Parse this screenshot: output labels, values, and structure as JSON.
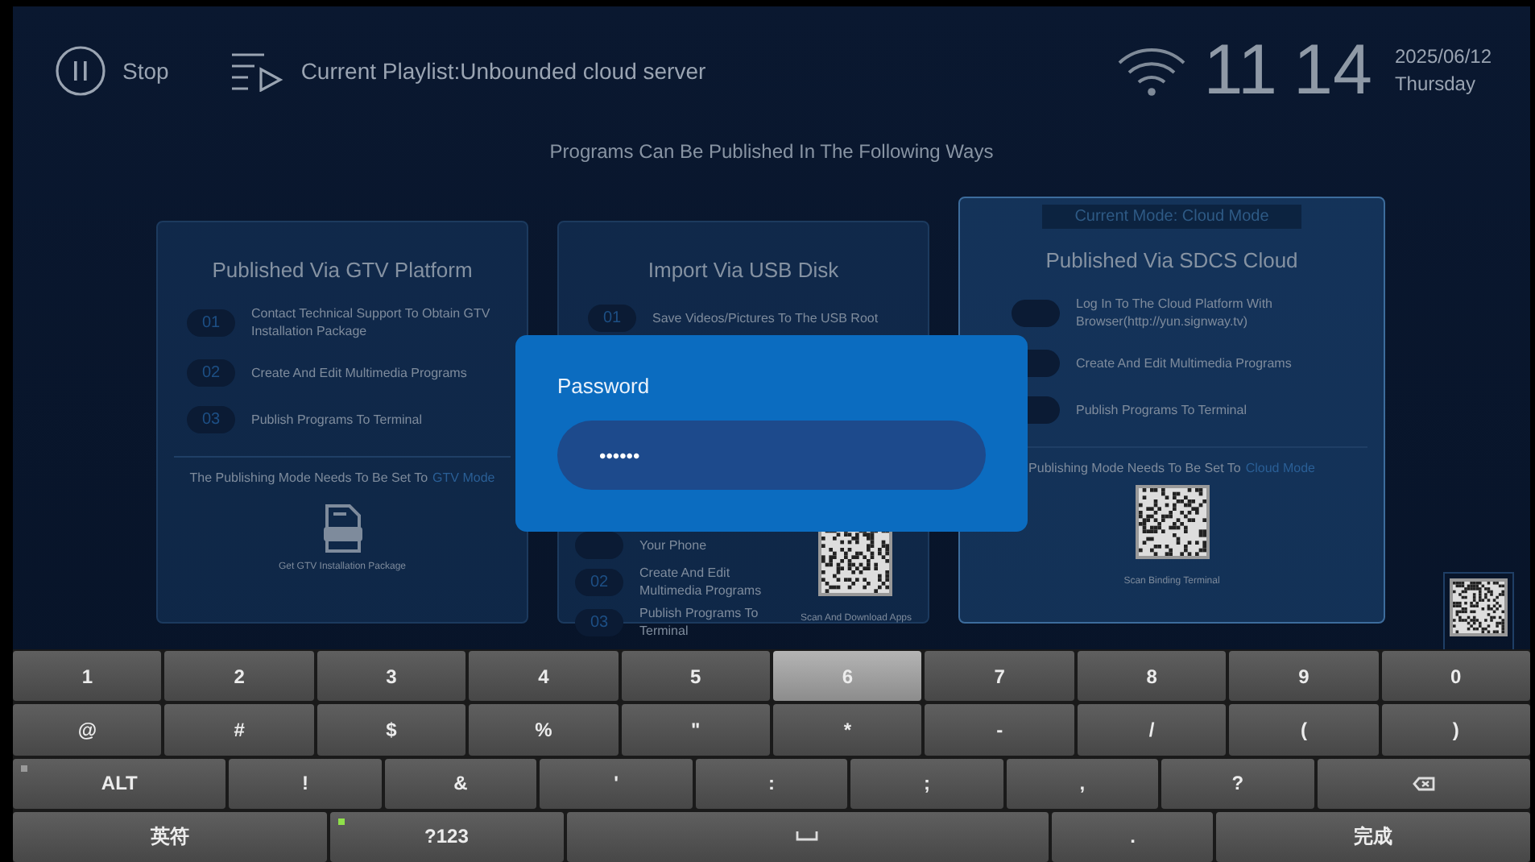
{
  "status_bar": {
    "playback_button": "Stop",
    "playlist": "Current Playlist:Unbounded cloud server",
    "time_hours": "11",
    "time_minutes": "14",
    "date": "2025/06/12",
    "weekday": "Thursday"
  },
  "heading": "Programs Can Be Published In The Following Ways",
  "cards": [
    {
      "title": "Published Via GTV Platform",
      "selected": false,
      "steps": [
        {
          "number": "01",
          "text": "Contact Technical Support To Obtain GTV Installation Package"
        },
        {
          "number": "02",
          "text": "Create And Edit Multimedia Programs"
        },
        {
          "number": "03",
          "text": "Publish Programs To Terminal"
        }
      ],
      "mode_note": "The Publishing Mode Needs To Be Set To",
      "mode_name": "GTV Mode",
      "download": {
        "kind": "package",
        "caption": "Get GTV Installation Package"
      }
    },
    {
      "title": "Import Via USB Disk",
      "selected": false,
      "steps": [
        {
          "number": "01",
          "text": "Save Videos/Pictures To The USB Root"
        }
      ],
      "side_section": {
        "steps": [
          {
            "text": "Your Phone"
          },
          {
            "number": "02",
            "text": "Create And Edit Multimedia Programs"
          },
          {
            "number": "03",
            "text": "Publish Programs To Terminal"
          }
        ],
        "download": {
          "kind": "qr",
          "caption": "Scan And Download Apps"
        }
      }
    },
    {
      "badge": "Current Mode: Cloud Mode",
      "title": "Published Via SDCS Cloud",
      "selected": true,
      "steps": [
        {
          "text": "Log In To The Cloud Platform With Browser(http://yun.signway.tv)"
        },
        {
          "text": "Create And Edit Multimedia Programs"
        },
        {
          "text": "Publish Programs To Terminal"
        }
      ],
      "mode_note": "Publishing Mode Needs To Be Set To",
      "mode_name": "Cloud Mode",
      "download": {
        "kind": "qr",
        "caption": "Scan Binding Terminal"
      }
    }
  ],
  "dialog": {
    "title": "Password",
    "value": "••••••"
  },
  "keyboard": [
    [
      {
        "kind": "char",
        "label": "1",
        "pressed": false
      },
      {
        "kind": "char",
        "label": "2",
        "pressed": false
      },
      {
        "kind": "char",
        "label": "3",
        "pressed": false
      },
      {
        "kind": "char",
        "label": "4",
        "pressed": false
      },
      {
        "kind": "char",
        "label": "5",
        "pressed": false
      },
      {
        "kind": "char",
        "label": "6",
        "pressed": true
      },
      {
        "kind": "char",
        "label": "7",
        "pressed": false
      },
      {
        "kind": "char",
        "label": "8",
        "pressed": false
      },
      {
        "kind": "char",
        "label": "9",
        "pressed": false
      },
      {
        "kind": "char",
        "label": "0",
        "pressed": false
      }
    ],
    [
      {
        "kind": "char",
        "label": "@",
        "pressed": false
      },
      {
        "kind": "char",
        "label": "#",
        "pressed": false
      },
      {
        "kind": "char",
        "label": "$",
        "pressed": false
      },
      {
        "kind": "char",
        "label": "%",
        "pressed": false
      },
      {
        "kind": "char",
        "label": "\"",
        "pressed": false
      },
      {
        "kind": "char",
        "label": "*",
        "pressed": false
      },
      {
        "kind": "char",
        "label": "-",
        "pressed": false
      },
      {
        "kind": "char",
        "label": "/",
        "pressed": false
      },
      {
        "kind": "char",
        "label": "(",
        "pressed": false
      },
      {
        "kind": "char",
        "label": ")",
        "pressed": false
      }
    ],
    [
      {
        "kind": "modifier",
        "label": "ALT",
        "lit": false,
        "pressed": false
      },
      {
        "kind": "char",
        "label": "!",
        "pressed": false
      },
      {
        "kind": "char",
        "label": "&",
        "pressed": false
      },
      {
        "kind": "char",
        "label": "'",
        "pressed": false
      },
      {
        "kind": "char",
        "label": ":",
        "pressed": false
      },
      {
        "kind": "char",
        "label": ";",
        "pressed": false
      },
      {
        "kind": "char",
        "label": ",",
        "pressed": false
      },
      {
        "kind": "char",
        "label": "?",
        "pressed": false
      },
      {
        "kind": "backspace",
        "pressed": false
      }
    ],
    [
      {
        "kind": "wide",
        "label": "英符",
        "pressed": false
      },
      {
        "kind": "modifier",
        "label": "?123",
        "lit": true,
        "pressed": false
      },
      {
        "kind": "space",
        "pressed": false
      },
      {
        "kind": "char",
        "label": ".",
        "pressed": false
      },
      {
        "kind": "wide",
        "label": "完成",
        "pressed": false
      }
    ]
  ]
}
